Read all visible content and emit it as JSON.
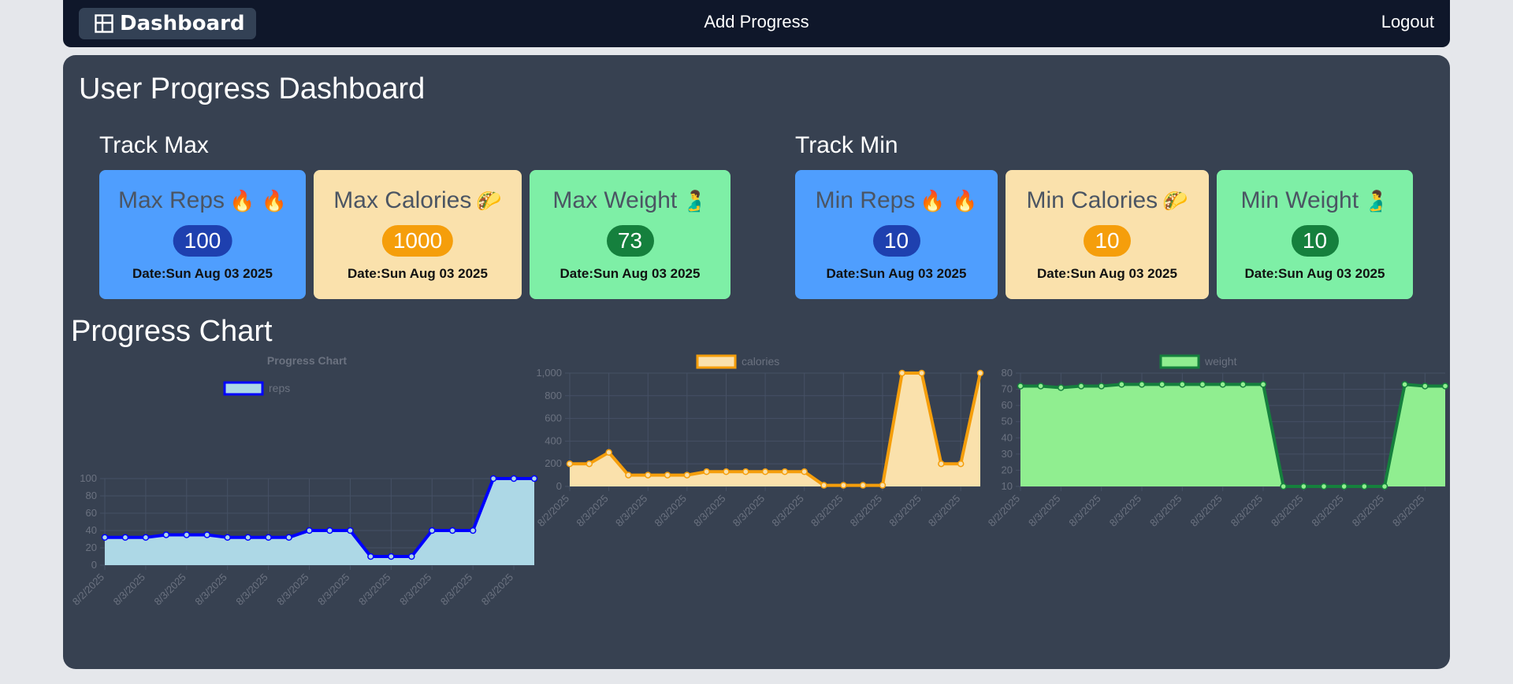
{
  "nav": {
    "brand": "Dashboard",
    "add_progress": "Add Progress",
    "logout": "Logout"
  },
  "page_title": "User Progress Dashboard",
  "track_max": {
    "title": "Track Max",
    "cards": [
      {
        "label": "Max Reps",
        "emoji": "🔥 🔥",
        "value": "100",
        "date": "Date:Sun Aug 03 2025",
        "color": "#4f9efe"
      },
      {
        "label": "Max Calories",
        "emoji": "🌮",
        "value": "1000",
        "date": "Date:Sun Aug 03 2025",
        "color": "#fae1ac"
      },
      {
        "label": "Max Weight",
        "emoji": "🫃",
        "value": "73",
        "date": "Date:Sun Aug 03 2025",
        "color": "#7eefa6"
      }
    ]
  },
  "track_min": {
    "title": "Track Min",
    "cards": [
      {
        "label": "Min Reps",
        "emoji": "🔥 🔥",
        "value": "10",
        "date": "Date:Sun Aug 03 2025",
        "color": "#4f9efe"
      },
      {
        "label": "Min Calories",
        "emoji": "🌮",
        "value": "10",
        "date": "Date:Sun Aug 03 2025",
        "color": "#fae1ac"
      },
      {
        "label": "Min Weight",
        "emoji": "🫃",
        "value": "10",
        "date": "Date:Sun Aug 03 2025",
        "color": "#7eefa6"
      }
    ]
  },
  "chart_section_title": "Progress Chart",
  "chart_data": [
    {
      "type": "area",
      "title": "Progress Chart",
      "x": [
        "8/2/2025",
        "8/3/2025",
        "8/3/2025",
        "8/3/2025",
        "8/3/2025",
        "8/3/2025",
        "8/3/2025",
        "8/3/2025",
        "8/3/2025",
        "8/3/2025",
        "8/3/2025",
        "8/3/2025",
        "8/3/2025",
        "8/3/2025",
        "8/3/2025",
        "8/3/2025",
        "8/3/2025",
        "8/3/2025",
        "8/3/2025",
        "8/3/2025",
        "8/3/2025",
        "8/3/2025"
      ],
      "series": [
        {
          "name": "reps",
          "values": [
            32,
            32,
            32,
            35,
            35,
            35,
            32,
            32,
            32,
            32,
            40,
            40,
            40,
            10,
            10,
            10,
            40,
            40,
            40,
            100,
            100,
            100
          ]
        }
      ],
      "yticks": [
        "0",
        "20",
        "40",
        "60",
        "80",
        "100"
      ],
      "ylim": [
        0,
        100
      ],
      "grid": true,
      "legend": "top",
      "line_color": "#0000ff",
      "fill_color": "#add8e6"
    },
    {
      "type": "area",
      "title": "",
      "x": [
        "8/2/2025",
        "8/3/2025",
        "8/3/2025",
        "8/3/2025",
        "8/3/2025",
        "8/3/2025",
        "8/3/2025",
        "8/3/2025",
        "8/3/2025",
        "8/3/2025",
        "8/3/2025",
        "8/3/2025",
        "8/3/2025",
        "8/3/2025",
        "8/3/2025",
        "8/3/2025",
        "8/3/2025",
        "8/3/2025",
        "8/3/2025",
        "8/3/2025",
        "8/3/2025",
        "8/3/2025"
      ],
      "series": [
        {
          "name": "calories",
          "values": [
            200,
            200,
            300,
            100,
            100,
            100,
            100,
            130,
            130,
            130,
            130,
            130,
            130,
            10,
            10,
            10,
            10,
            1000,
            1000,
            200,
            200,
            1000
          ]
        }
      ],
      "yticks": [
        "0",
        "200",
        "400",
        "600",
        "800",
        "1,000"
      ],
      "ylim": [
        0,
        1000
      ],
      "grid": true,
      "legend": "top",
      "line_color": "#f59e0b",
      "fill_color": "#fae1ac"
    },
    {
      "type": "area",
      "title": "",
      "x": [
        "8/2/2025",
        "8/3/2025",
        "8/3/2025",
        "8/3/2025",
        "8/3/2025",
        "8/3/2025",
        "8/3/2025",
        "8/3/2025",
        "8/3/2025",
        "8/3/2025",
        "8/3/2025",
        "8/3/2025",
        "8/3/2025",
        "8/3/2025",
        "8/3/2025",
        "8/3/2025",
        "8/3/2025",
        "8/3/2025",
        "8/3/2025",
        "8/3/2025",
        "8/3/2025",
        "8/3/2025"
      ],
      "series": [
        {
          "name": "weight",
          "values": [
            72,
            72,
            71,
            72,
            72,
            73,
            73,
            73,
            73,
            73,
            73,
            73,
            73,
            10,
            10,
            10,
            10,
            10,
            10,
            73,
            72,
            72
          ]
        }
      ],
      "yticks": [
        "10",
        "20",
        "30",
        "40",
        "50",
        "60",
        "70",
        "80"
      ],
      "ylim": [
        10,
        80
      ],
      "grid": true,
      "legend": "top",
      "line_color": "#15803d",
      "fill_color": "#90ee90"
    }
  ]
}
